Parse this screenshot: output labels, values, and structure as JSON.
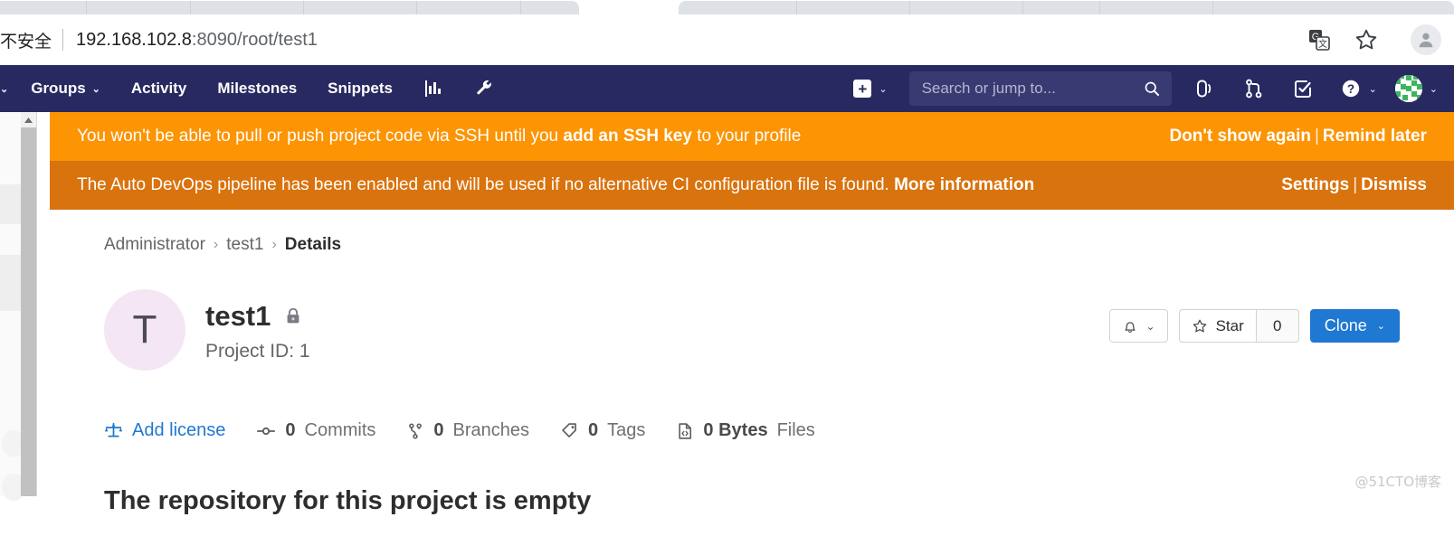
{
  "browser": {
    "security_label": "不安全",
    "url_host": "192.168.102.8",
    "url_rest": ":8090/root/test1",
    "icons": {
      "translate": "translate-icon",
      "bookmark": "star-bookmark-icon",
      "profile": "browser-profile-avatar"
    }
  },
  "topnav": {
    "items": [
      {
        "label": "Groups",
        "has_chevron": true
      },
      {
        "label": "Activity",
        "has_chevron": false
      },
      {
        "label": "Milestones",
        "has_chevron": false
      },
      {
        "label": "Snippets",
        "has_chevron": false
      }
    ],
    "icon_buttons": [
      {
        "name": "analytics-chart-icon"
      },
      {
        "name": "wrench-admin-icon"
      }
    ],
    "create_new": {
      "label": "+",
      "name": "create-new-dropdown"
    },
    "search": {
      "placeholder": "Search or jump to...",
      "value": ""
    },
    "right_icons": [
      {
        "name": "issues-icon"
      },
      {
        "name": "merge-requests-icon"
      },
      {
        "name": "todos-icon"
      }
    ],
    "help": {
      "name": "help-icon"
    },
    "user": {
      "name": "user-avatar"
    }
  },
  "banners": [
    {
      "text_before": "You won't be able to pull or push project code via SSH until you ",
      "link": "add an SSH key",
      "text_after": " to your profile",
      "action_1": "Don't show again",
      "separator": "|",
      "action_2": "Remind later",
      "color": "#fc9403"
    },
    {
      "text_before": "The Auto DevOps pipeline has been enabled and will be used if no alternative CI configuration file is found. ",
      "link": "More information",
      "text_after": "",
      "action_1": "Settings",
      "separator": "|",
      "action_2": "Dismiss",
      "color": "#d9730d"
    }
  ],
  "breadcrumb": {
    "items": [
      "Administrator",
      "test1",
      "Details"
    ],
    "separator": "›"
  },
  "project": {
    "avatar_letter": "T",
    "name": "test1",
    "visibility_icon": "lock-icon",
    "project_id_label": "Project ID: 1",
    "actions": {
      "notifications_label": "",
      "star_label": "Star",
      "star_count": "0",
      "clone_label": "Clone"
    },
    "stats": [
      {
        "icon": "license-scale-icon",
        "count": "",
        "label": "Add license",
        "is_link": true
      },
      {
        "icon": "commit-icon",
        "count": "0",
        "label": "Commits",
        "is_link": false
      },
      {
        "icon": "branch-icon",
        "count": "0",
        "label": "Branches",
        "is_link": false
      },
      {
        "icon": "tag-icon",
        "count": "0",
        "label": "Tags",
        "is_link": false
      },
      {
        "icon": "file-code-icon",
        "count": "0 Bytes",
        "label": "Files",
        "is_link": false
      }
    ],
    "empty_message": "The repository for this project is empty"
  },
  "watermark": "@51CTO博客"
}
